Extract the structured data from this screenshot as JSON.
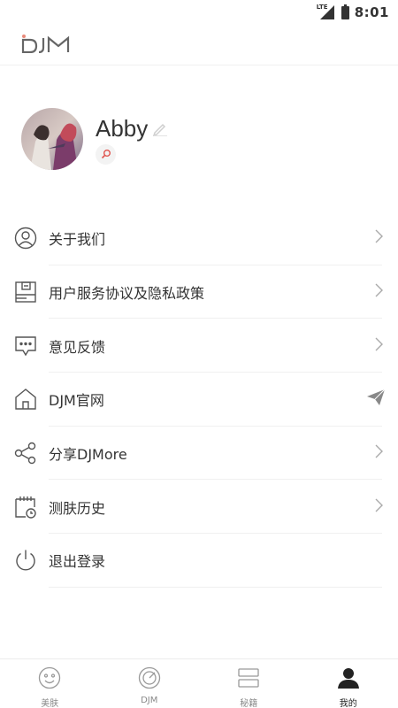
{
  "status_bar": {
    "network": "LTE",
    "time": "8:01"
  },
  "header": {
    "logo_text": "DJM"
  },
  "profile": {
    "username": "Abby"
  },
  "menu": {
    "items": [
      {
        "label": "关于我们",
        "icon": "user-circle-icon"
      },
      {
        "label": "用户服务协议及隐私政策",
        "icon": "document-icon"
      },
      {
        "label": "意见反馈",
        "icon": "chat-bubble-icon"
      },
      {
        "label": "DJM官网",
        "icon": "home-icon"
      },
      {
        "label": "分享DJMore",
        "icon": "share-icon"
      },
      {
        "label": "测肤历史",
        "icon": "calendar-clock-icon"
      },
      {
        "label": "退出登录",
        "icon": "power-icon"
      }
    ]
  },
  "bottom_nav": {
    "items": [
      {
        "label": "美肤",
        "icon": "smile-face-icon"
      },
      {
        "label": "DJM",
        "icon": "gauge-icon"
      },
      {
        "label": "秘籍",
        "icon": "stack-icon"
      },
      {
        "label": "我的",
        "icon": "person-icon"
      }
    ],
    "active_index": 3
  },
  "colors": {
    "text_primary": "#333333",
    "icon_gray": "#555555",
    "logo_accent": "#e88a7a",
    "divider": "#f0f0f0"
  }
}
